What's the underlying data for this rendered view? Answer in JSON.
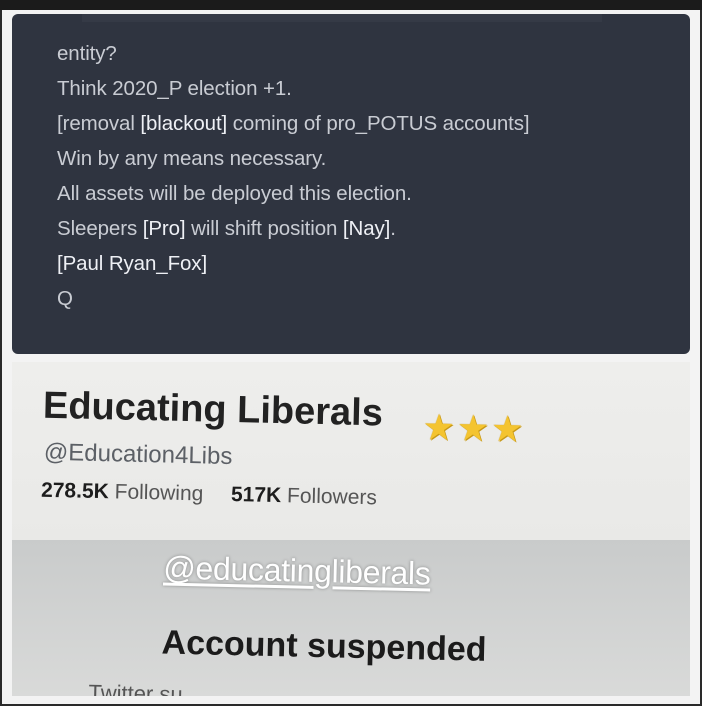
{
  "post": {
    "lines": [
      {
        "parts": [
          {
            "text": "entity?",
            "hl": false
          }
        ]
      },
      {
        "parts": [
          {
            "text": "Think 2020_P election +1.",
            "hl": false
          }
        ]
      },
      {
        "parts": [
          {
            "text": "[removal ",
            "hl": false
          },
          {
            "text": "[blackout]",
            "hl": true
          },
          {
            "text": " coming of pro_POTUS accounts]",
            "hl": false
          }
        ]
      },
      {
        "parts": [
          {
            "text": "Win by any means necessary.",
            "hl": false
          }
        ]
      },
      {
        "parts": [
          {
            "text": "All assets will be deployed this election.",
            "hl": false
          }
        ]
      },
      {
        "parts": [
          {
            "text": "Sleepers ",
            "hl": false
          },
          {
            "text": "[Pro]",
            "hl": true
          },
          {
            "text": " will shift position ",
            "hl": false
          },
          {
            "text": "[Nay]",
            "hl": true
          },
          {
            "text": ".",
            "hl": false
          }
        ]
      },
      {
        "parts": [
          {
            "text": "[Paul Ryan_Fox]",
            "hl": true
          }
        ]
      },
      {
        "parts": [
          {
            "text": "Q",
            "hl": false
          }
        ]
      }
    ]
  },
  "profile": {
    "display_name": "Educating Liberals",
    "stars": [
      "★",
      "★",
      "★"
    ],
    "handle": "@Education4Libs",
    "following_count": "278.5K",
    "following_label": "Following",
    "followers_count": "517K",
    "followers_label": "Followers",
    "overlay_tag": "@educatingliberals",
    "suspended_title": "Account suspended",
    "cut_text": "Twitter su"
  },
  "colors": {
    "post_bg": "#2f3440",
    "post_text": "#c9ccd3",
    "star": "#f4c430"
  }
}
